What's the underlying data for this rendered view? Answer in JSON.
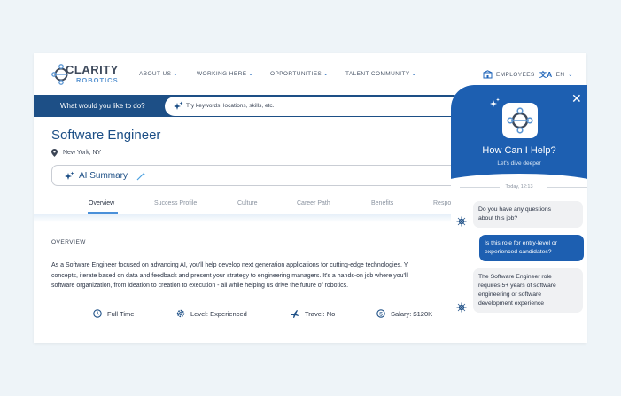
{
  "brand": {
    "line1": "CLARITY",
    "line2": "ROBOTICS"
  },
  "nav": [
    {
      "label": "ABOUT US"
    },
    {
      "label": "WORKING HERE"
    },
    {
      "label": "OPPORTUNITIES"
    },
    {
      "label": "TALENT COMMUNITY"
    }
  ],
  "header_right": {
    "employees": "EMPLOYEES",
    "language": "EN"
  },
  "search": {
    "prompt": "What would you like to do?",
    "placeholder": "Try keywords, locations, skills, etc."
  },
  "job": {
    "title": "Software Engineer",
    "location": "New York, NY",
    "ai_summary": "AI Summary"
  },
  "tabs": [
    "Overview",
    "Success Profile",
    "Culture",
    "Career Path",
    "Benefits",
    "Respo"
  ],
  "active_tab": "Overview",
  "overview": {
    "heading": "OVERVIEW",
    "lines": [
      "As a Software Engineer focused on advancing AI, you'll help develop next generation applications for cutting-edge technologies. Y",
      "concepts, iterate based on data and feedback and present your strategy to engineering managers. It's a hands-on job where you'll",
      "software organization, from ideation to creation to execution - all while helping us drive the future of robotics."
    ]
  },
  "facts": [
    {
      "icon": "clock-icon",
      "label": "Full Time"
    },
    {
      "icon": "gear-icon",
      "label": "Level: Experienced"
    },
    {
      "icon": "plane-icon",
      "label": "Travel: No"
    },
    {
      "icon": "dollar-icon",
      "label": "Salary: $120K"
    }
  ],
  "chat": {
    "title": "How Can I Help?",
    "subtitle": "Let's dive deeper",
    "date": "Today, 12:13",
    "messages": [
      {
        "from": "bot",
        "text_lines": [
          "Do you have any questions",
          "about this job?"
        ]
      },
      {
        "from": "user",
        "text_lines": [
          "Is this role for entry-level or",
          "experienced candidates?"
        ]
      },
      {
        "from": "bot",
        "text_lines": [
          "The Software Engineer role",
          "requires 5+ years of software",
          "engineering or software",
          "development experience"
        ]
      }
    ]
  },
  "colors": {
    "primary": "#1d4f86",
    "chat_blue": "#1d5fb1",
    "accent": "#4a90d9"
  }
}
